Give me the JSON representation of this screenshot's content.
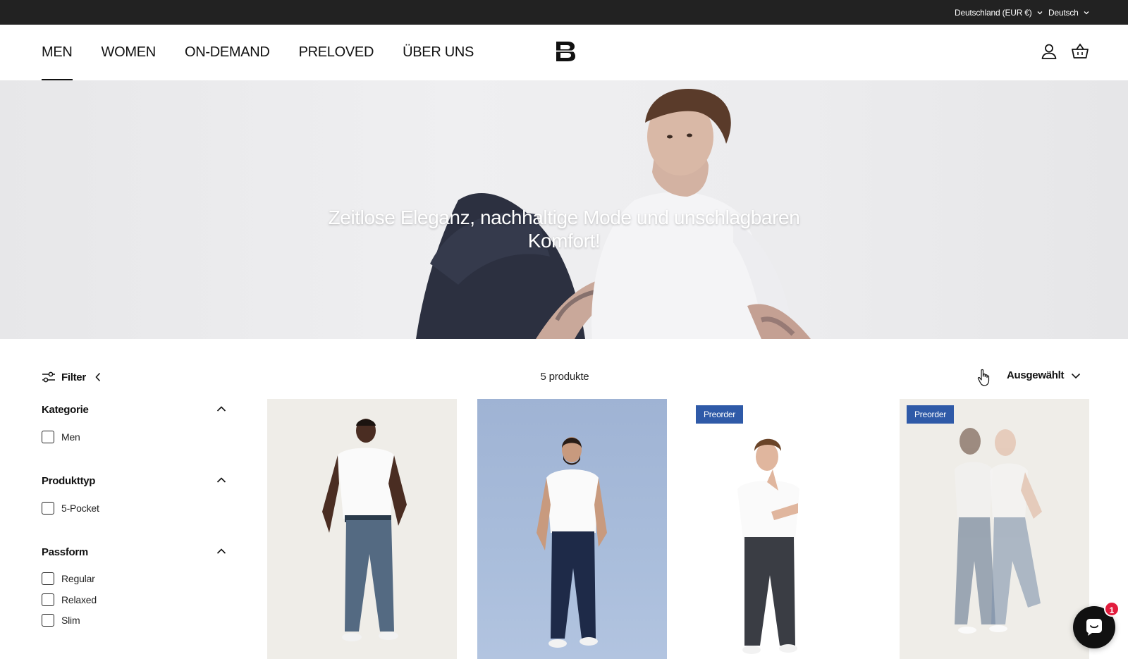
{
  "topbar": {
    "country": "Deutschland (EUR €)",
    "language": "Deutsch"
  },
  "nav": {
    "items": [
      {
        "label": "MEN",
        "active": true
      },
      {
        "label": "WOMEN",
        "active": false
      },
      {
        "label": "ON-DEMAND",
        "active": false
      },
      {
        "label": "PRELOVED",
        "active": false
      },
      {
        "label": "ÜBER UNS",
        "active": false
      }
    ]
  },
  "header": {
    "logo_icon": "brand-b-logo",
    "account_icon": "user-icon",
    "cart_icon": "basket-icon"
  },
  "hero": {
    "title": "Zeitlose Eleganz, nachhaltige Mode und unschlagbaren Komfort!"
  },
  "filter": {
    "label": "Filter",
    "groups": [
      {
        "title": "Kategorie",
        "expanded": true,
        "options": [
          "Men"
        ]
      },
      {
        "title": "Produkttyp",
        "expanded": true,
        "options": [
          "5-Pocket"
        ]
      },
      {
        "title": "Passform",
        "expanded": true,
        "options": [
          "Regular",
          "Relaxed",
          "Slim"
        ]
      }
    ]
  },
  "toolbar": {
    "count": "5 produkte",
    "sort_label": "Ausgewählt"
  },
  "products": [
    {
      "badge": ""
    },
    {
      "badge": ""
    },
    {
      "badge": "Preorder"
    },
    {
      "badge": "Preorder"
    }
  ],
  "colors": {
    "topbar": "#222222",
    "badge": "#2f5aa8",
    "notification": "#e21c3d"
  },
  "chat": {
    "notification_count": "1"
  }
}
